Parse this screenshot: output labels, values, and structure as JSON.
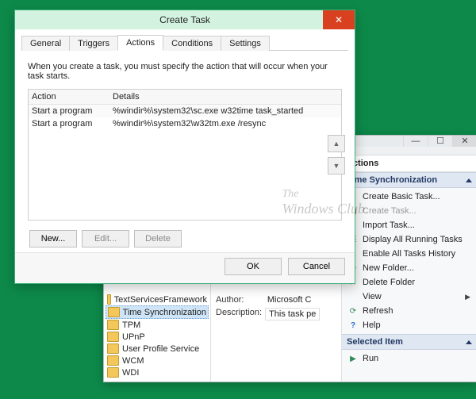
{
  "dialog": {
    "title": "Create Task",
    "close_glyph": "✕",
    "tabs": {
      "general": "General",
      "triggers": "Triggers",
      "actions": "Actions",
      "conditions": "Conditions",
      "settings": "Settings"
    },
    "instruction": "When you create a task, you must specify the action that will occur when your task starts.",
    "columns": {
      "action": "Action",
      "details": "Details"
    },
    "rows": [
      {
        "action": "Start a program",
        "details": "%windir%\\system32\\sc.exe w32time task_started"
      },
      {
        "action": "Start a program",
        "details": "%windir%\\system32\\w32tm.exe /resync"
      }
    ],
    "up_glyph": "▲",
    "down_glyph": "▼",
    "buttons": {
      "new": "New...",
      "edit": "Edit...",
      "delete": "Delete",
      "ok": "OK",
      "cancel": "Cancel"
    }
  },
  "tsw": {
    "min_glyph": "—",
    "max_glyph": "☐",
    "close_glyph": "✕",
    "tree": [
      "TextServicesFramework",
      "Time Synchronization",
      "TPM",
      "UPnP",
      "User Profile Service",
      "WCM",
      "WDI"
    ],
    "tree_selected_index": 1,
    "mid": {
      "author_label": "Author:",
      "author_value": "Microsoft C",
      "desc_label": "Description:",
      "desc_value": "This task pe"
    },
    "actions_header": "Actions",
    "section_time": "Time Synchronization",
    "items": {
      "create_basic": "Create Basic Task...",
      "create_task": "Create Task...",
      "import_task": "Import Task...",
      "display_all": "Display All Running Tasks",
      "enable_hist": "Enable All Tasks History",
      "new_folder": "New Folder...",
      "delete_folder": "Delete Folder",
      "view": "View",
      "refresh": "Refresh",
      "help": "Help"
    },
    "section_selected": "Selected Item",
    "selected_items": {
      "run": "Run"
    }
  },
  "watermark": {
    "line1": "The",
    "line2": "Windows Club"
  }
}
